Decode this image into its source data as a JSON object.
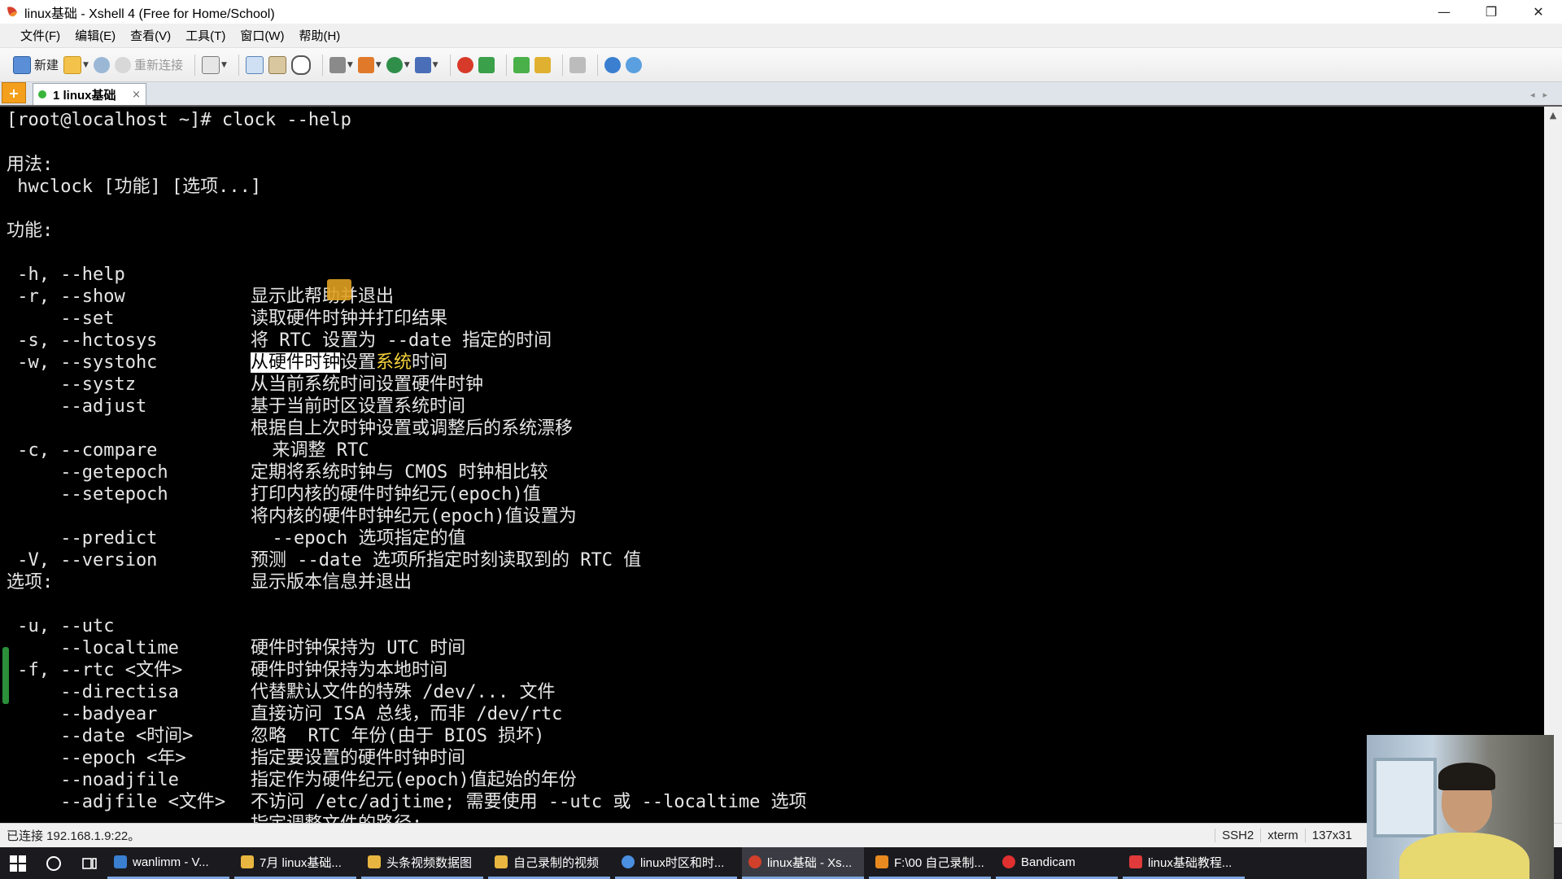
{
  "window": {
    "title": "linux基础 - Xshell 4 (Free for Home/School)",
    "minimize": "—",
    "restore": "❐",
    "close": "✕"
  },
  "menu": [
    "文件(F)",
    "编辑(E)",
    "查看(V)",
    "工具(T)",
    "窗口(W)",
    "帮助(H)"
  ],
  "toolbar": {
    "new_label": "新建",
    "reconnect_label": "重新连接"
  },
  "tabs": {
    "active_label": "1 linux基础",
    "close_glyph": "×",
    "add_glyph": "+",
    "nav": "◂▸"
  },
  "terminal": {
    "prompt_line": "[root@localhost ~]# clock --help",
    "usage_header": "用法:",
    "usage_line": " hwclock [功能] [选项...]",
    "functions_header": "功能:",
    "functions": [
      {
        "opt": " -h, --help",
        "desc": "显示此帮助并退出"
      },
      {
        "opt": " -r, --show",
        "desc": "读取硬件时钟并打印结果"
      },
      {
        "opt": "     --set",
        "desc": "将 RTC 设置为 --date 指定的时间"
      },
      {
        "opt": " -s, --hctosys",
        "desc_hl": "从硬件时钟",
        "desc_mid": "设置",
        "desc_yl": "系统",
        "desc_rest": "时间"
      },
      {
        "opt": " -w, --systohc",
        "desc": "从当前系统时间设置硬件时钟"
      },
      {
        "opt": "     --systz",
        "desc": "基于当前时区设置系统时间"
      },
      {
        "opt": "     --adjust",
        "desc": "根据自上次时钟设置或调整后的系统漂移"
      },
      {
        "opt": "",
        "desc": "  来调整 RTC"
      },
      {
        "opt": " -c, --compare",
        "desc": "定期将系统时钟与 CMOS 时钟相比较"
      },
      {
        "opt": "     --getepoch",
        "desc": "打印内核的硬件时钟纪元(epoch)值"
      },
      {
        "opt": "     --setepoch",
        "desc": "将内核的硬件时钟纪元(epoch)值设置为"
      },
      {
        "opt": "",
        "desc": "  --epoch 选项指定的值"
      },
      {
        "opt": "     --predict",
        "desc": "预测 --date 选项所指定时刻读取到的 RTC 值"
      },
      {
        "opt": " -V, --version",
        "desc": "显示版本信息并退出"
      }
    ],
    "options_header": "选项:",
    "options": [
      {
        "opt": " -u, --utc",
        "desc": "硬件时钟保持为 UTC 时间"
      },
      {
        "opt": "     --localtime",
        "desc": "硬件时钟保持为本地时间"
      },
      {
        "opt": " -f, --rtc <文件>",
        "desc": "代替默认文件的特殊 /dev/... 文件"
      },
      {
        "opt": "     --directisa",
        "desc": "直接访问 ISA 总线，而非 /dev/rtc"
      },
      {
        "opt": "     --badyear",
        "desc": "忽略  RTC 年份(由于 BIOS 损坏)"
      },
      {
        "opt": "     --date <时间>",
        "desc": "指定要设置的硬件时钟时间"
      },
      {
        "opt": "     --epoch <年>",
        "desc": "指定作为硬件纪元(epoch)值起始的年份"
      },
      {
        "opt": "     --noadjfile",
        "desc": "不访问 /etc/adjtime; 需要使用 --utc 或 --localtime 选项"
      },
      {
        "opt": "     --adjfile <文件>",
        "desc": "指定调整文件的路径;"
      }
    ]
  },
  "status": {
    "connection": "已连接 192.168.1.9:22。",
    "protocol": "SSH2",
    "term": "xterm",
    "size": "137x31"
  },
  "taskbar": {
    "tasks": [
      {
        "label": "wanlimm - V...",
        "color": "#3a7fd0"
      },
      {
        "label": "7月 linux基础...",
        "color": "#e8b640"
      },
      {
        "label": "头条视频数据图",
        "color": "#e8b640"
      },
      {
        "label": "自己录制的视频",
        "color": "#e8b640"
      },
      {
        "label": "linux时区和时...",
        "color": "#4a8fe0"
      },
      {
        "label": "linux基础 - Xs...",
        "color": "#d0402a"
      },
      {
        "label": "F:\\00 自己录制...",
        "color": "#e88a20"
      },
      {
        "label": "Bandicam",
        "color": "#e03030"
      },
      {
        "label": "linux基础教程...",
        "color": "#e03a3a"
      }
    ],
    "active_index": 5,
    "tray_up": "^"
  },
  "colors": {
    "terminal_bg": "#000000",
    "terminal_fg": "#e6e6e6",
    "highlight_bg": "#ffffff",
    "highlight_fg": "#000000",
    "yellow_text": "#f3d23a",
    "taskbar_bg": "#1b1b1f",
    "tab_active_dot": "#3ab53a"
  }
}
